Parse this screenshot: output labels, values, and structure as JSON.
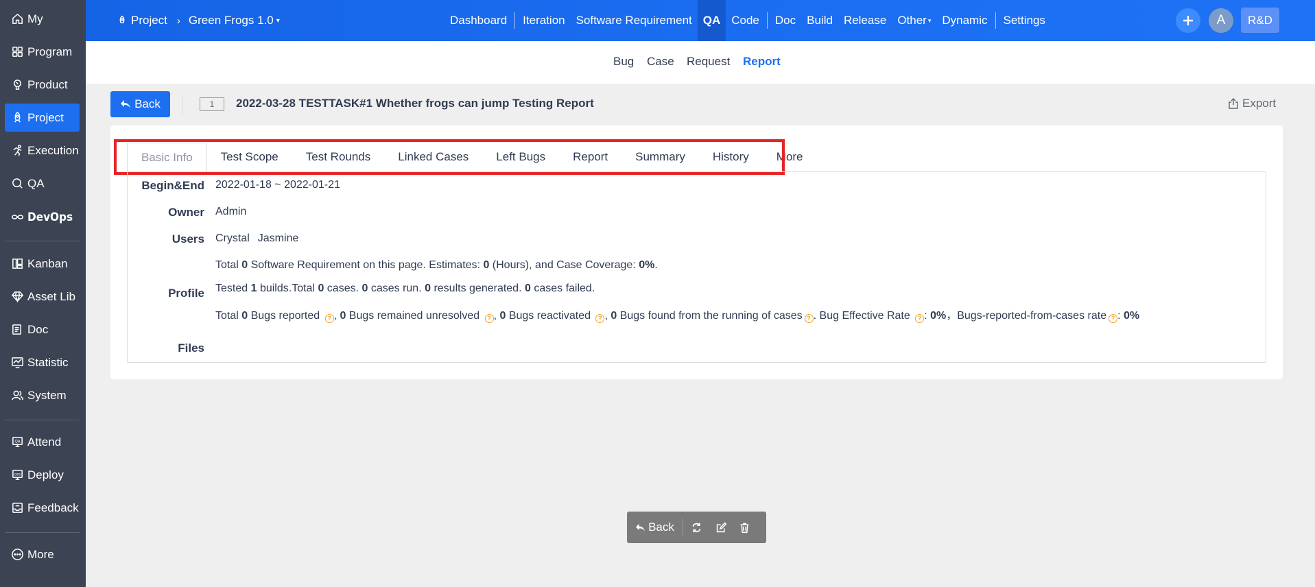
{
  "sidebar": {
    "items": [
      {
        "label": "My",
        "icon": "home-icon"
      },
      {
        "label": "Program",
        "icon": "grid-icon"
      },
      {
        "label": "Product",
        "icon": "bulb-icon"
      },
      {
        "label": "Project",
        "icon": "rocket-icon"
      },
      {
        "label": "Execution",
        "icon": "run-icon"
      },
      {
        "label": "QA",
        "icon": "magnifier-icon"
      },
      {
        "label": "DevOps",
        "icon": "infinity-icon"
      },
      {
        "label": "Kanban",
        "icon": "kanban-icon"
      },
      {
        "label": "Asset Lib",
        "icon": "diamond-icon"
      },
      {
        "label": "Doc",
        "icon": "doc-icon"
      },
      {
        "label": "Statistic",
        "icon": "chart-icon"
      },
      {
        "label": "System",
        "icon": "users-icon"
      },
      {
        "label": "Attend",
        "icon": "attend-icon"
      },
      {
        "label": "Deploy",
        "icon": "ops-icon"
      },
      {
        "label": "Feedback",
        "icon": "inbox-icon"
      },
      {
        "label": "More",
        "icon": "more-icon"
      }
    ],
    "active": "Project"
  },
  "header": {
    "breadcrumb_root": "Project",
    "breadcrumb_project": "Green Frogs 1.0",
    "nav": [
      "Dashboard",
      "Iteration",
      "Software Requirement",
      "QA",
      "Code",
      "Doc",
      "Build",
      "Release",
      "Other",
      "Dynamic",
      "Settings"
    ],
    "active_nav": "QA",
    "avatar_letter": "A",
    "role_label": "R&D"
  },
  "subnav": {
    "items": [
      "Bug",
      "Case",
      "Request",
      "Report"
    ],
    "active": "Report"
  },
  "page": {
    "back_label": "Back",
    "id_badge": "1",
    "title": "2022-03-28 TESTTASK#1 Whether frogs can jump Testing Report",
    "export_label": "Export"
  },
  "tabs": [
    "Basic Info",
    "Test Scope",
    "Test Rounds",
    "Linked Cases",
    "Left Bugs",
    "Report",
    "Summary",
    "History",
    "More"
  ],
  "info": {
    "begin_end_label": "Begin&End",
    "begin_end_value": "2022-01-18 ~ 2022-01-21",
    "owner_label": "Owner",
    "owner_value": "Admin",
    "users_label": "Users",
    "users_value_1": "Crystal",
    "users_value_2": "Jasmine",
    "profile_label": "Profile",
    "files_label": "Files",
    "profile": {
      "line1": {
        "p1": "Total ",
        "n1": "0",
        "p2": " Software Requirement on this page. Estimates: ",
        "n2": "0",
        "p3": " (Hours), and Case Coverage: ",
        "n3": "0%",
        "p4": "."
      },
      "line2": {
        "p1": "Tested ",
        "n1": "1",
        "p2": " builds.Total ",
        "n2": "0",
        "p3": " cases. ",
        "n3": "0",
        "p4": " cases run. ",
        "n4": "0",
        "p5": " results generated. ",
        "n5": "0",
        "p6": " cases failed."
      },
      "line3": {
        "p1": "Total ",
        "n1": "0",
        "p2": " Bugs reported ",
        "p3": ", ",
        "n2": "0",
        "p4": " Bugs remained unresolved ",
        "p5": ", ",
        "n3": "0",
        "p6": " Bugs reactivated ",
        "p7": ", ",
        "n4": "0",
        "p8": " Bugs found from the running of cases",
        "p9": ". Bug Effective Rate ",
        "p10": ": ",
        "n5": "0%",
        "p11": "，Bugs-reported-from-cases rate",
        "p12": ": ",
        "n6": "0%"
      }
    }
  },
  "actionbar": {
    "back_label": "Back"
  },
  "colors": {
    "sidebar_bg": "#3c4353",
    "primary": "#1d6ff0",
    "highlight_border": "#e52525",
    "help_icon": "#f1a325"
  }
}
